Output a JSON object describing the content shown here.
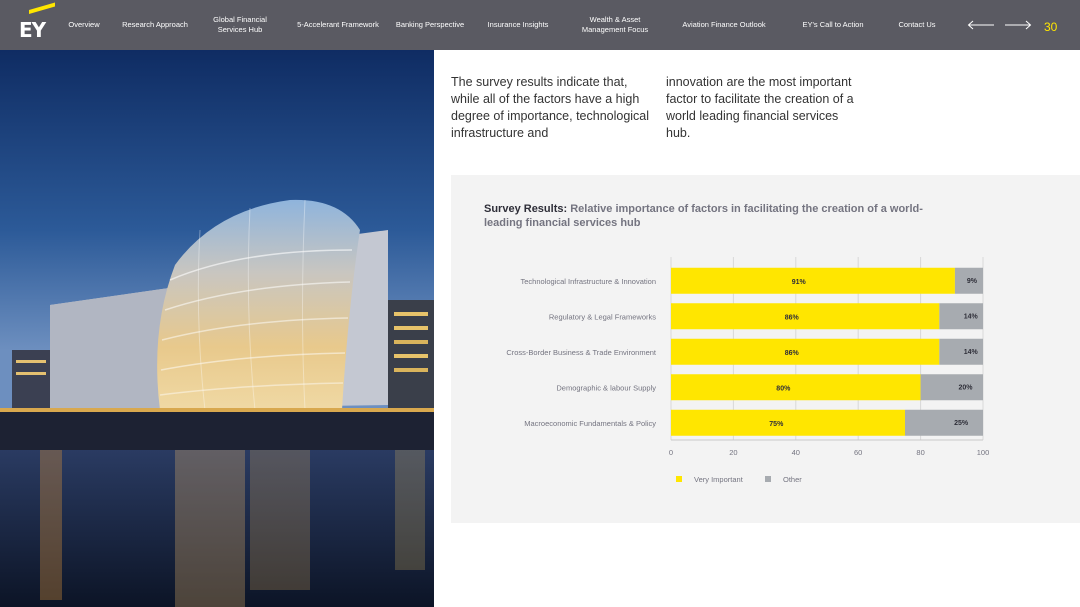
{
  "nav": {
    "logo_text": "EY",
    "items": [
      {
        "label": "Overview"
      },
      {
        "label": "Research Approach"
      },
      {
        "label": "Global Financial Services Hub"
      },
      {
        "label": "5-Accelerant Framework"
      },
      {
        "label": "Banking Perspective"
      },
      {
        "label": "Insurance Insights"
      },
      {
        "label": "Wealth & Asset Management Focus"
      },
      {
        "label": "Aviation Finance Outlook"
      },
      {
        "label": "EY's Call to Action"
      },
      {
        "label": "Contact Us"
      }
    ],
    "prev_icon": "arrow-left-icon",
    "next_icon": "arrow-right-icon",
    "page_number": "30"
  },
  "intro": {
    "col1": "The survey results indicate that, while all of the factors have a high degree of importance, technological infrastructure and",
    "col2": "innovation are the most important factor to facilitate the creation of a world leading financial services hub."
  },
  "chart_title": {
    "lead": "Survey Results:",
    "rest": "Relative importance of factors in facilitating the creation of a world-leading financial services hub"
  },
  "colors": {
    "nav_bg": "#5a5a62",
    "accent_yellow": "#ffe600",
    "other_gray": "#a7abb0",
    "panel_bg": "#f3f3f3"
  },
  "chart_data": {
    "type": "bar",
    "orientation": "horizontal",
    "stacked": true,
    "categories": [
      "Technological Infrastructure & Innovation",
      "Regulatory & Legal Frameworks",
      "Cross-Border Business & Trade Environment",
      "Demographic & labour Supply",
      "Macroeconomic Fundamentals & Policy"
    ],
    "series": [
      {
        "name": "Very Important",
        "color": "#ffe600",
        "values": [
          91,
          86,
          86,
          80,
          75
        ],
        "labels": [
          "91%",
          "86%",
          "86%",
          "80%",
          "75%"
        ]
      },
      {
        "name": "Other",
        "color": "#a7abb0",
        "values": [
          9,
          14,
          14,
          20,
          25
        ],
        "labels": [
          "9%",
          "14%",
          "14%",
          "20%",
          "25%"
        ]
      }
    ],
    "xlim": [
      0,
      100
    ],
    "xticks": [
      "0",
      "20",
      "40",
      "60",
      "80",
      "100"
    ],
    "grid": true,
    "legend": "bottom"
  }
}
